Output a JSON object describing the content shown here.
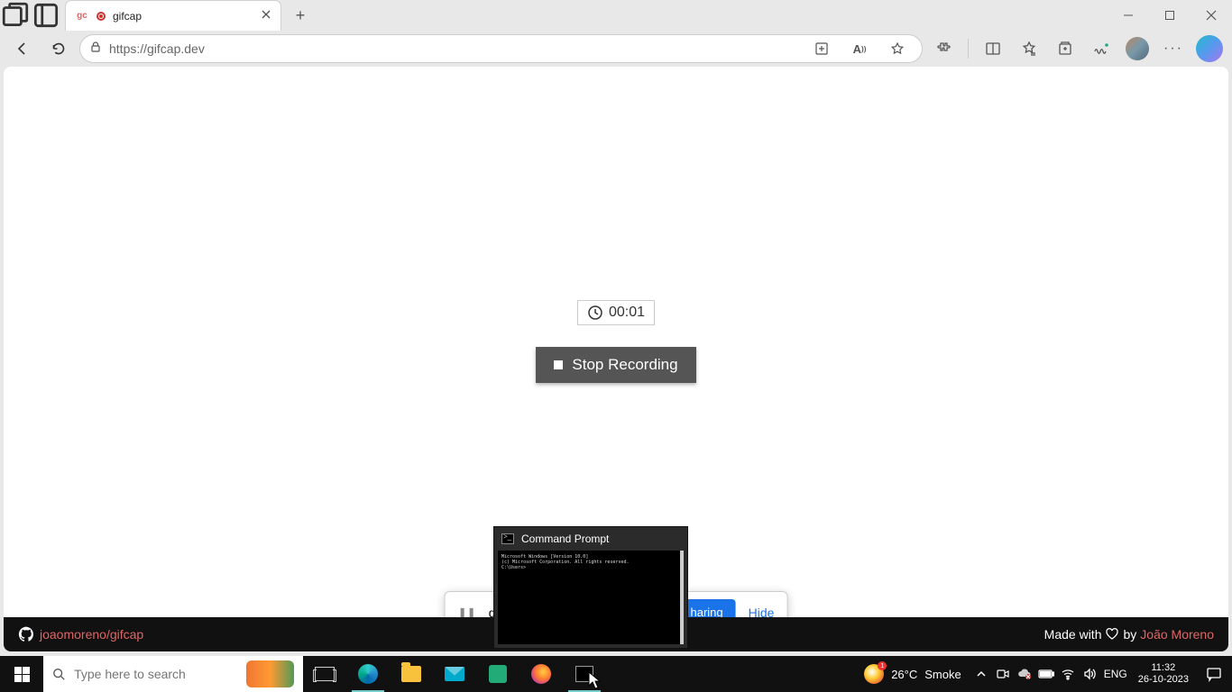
{
  "browser": {
    "tab": {
      "favicon_text": "gc",
      "title": "gifcap"
    },
    "url": "https://gifcap.dev"
  },
  "page": {
    "timer": "00:01",
    "stop_label": "Stop Recording",
    "share_prefix": "gifc",
    "share_suffix": "haring",
    "hide_label": "Hide",
    "footer": {
      "repo": "joaomoreno/gifcap",
      "made_prefix": "Made with ",
      "made_by": " by ",
      "author": "João Moreno"
    }
  },
  "cmd_preview": {
    "title": "Command Prompt",
    "lines": [
      "Microsoft Windows [Version 10.0]",
      "(c) Microsoft Corporation. All rights reserved.",
      "C:\\Users>"
    ]
  },
  "taskbar": {
    "search_placeholder": "Type here to search",
    "weather_temp": "26°C",
    "weather_cond": "Smoke",
    "weather_badge": "1",
    "lang": "ENG",
    "time": "11:32",
    "date": "26-10-2023"
  }
}
